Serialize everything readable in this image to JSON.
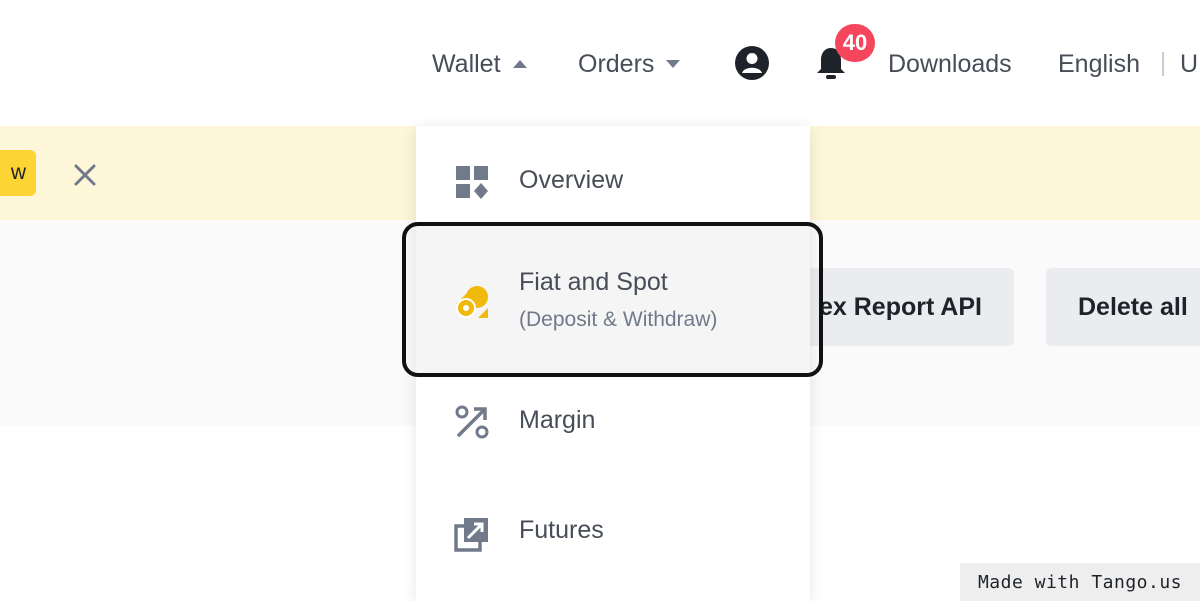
{
  "nav": {
    "wallet": "Wallet",
    "orders": "Orders",
    "notification_count": "40",
    "downloads": "Downloads",
    "language": "English",
    "cut_item": "U"
  },
  "banner": {
    "button_fragment": "w"
  },
  "content": {
    "report_api_button": "ex Report API",
    "delete_all_button": "Delete all"
  },
  "wallet_menu": {
    "items": [
      {
        "label": "Overview",
        "icon": "overview-grid-icon"
      },
      {
        "label": "Fiat and Spot",
        "sublabel": "(Deposit & Withdraw)",
        "icon": "fiat-spot-coin-icon",
        "highlighted": true
      },
      {
        "label": "Margin",
        "icon": "margin-percent-icon"
      },
      {
        "label": "Futures",
        "icon": "futures-chart-icon"
      }
    ]
  },
  "watermark": "Made with Tango.us",
  "colors": {
    "accent_yellow": "#fcd535",
    "banner_bg": "#fdf6d8",
    "badge_red": "#f6465d",
    "icon_grey": "#707a8a",
    "text_dark": "#1e2329"
  }
}
